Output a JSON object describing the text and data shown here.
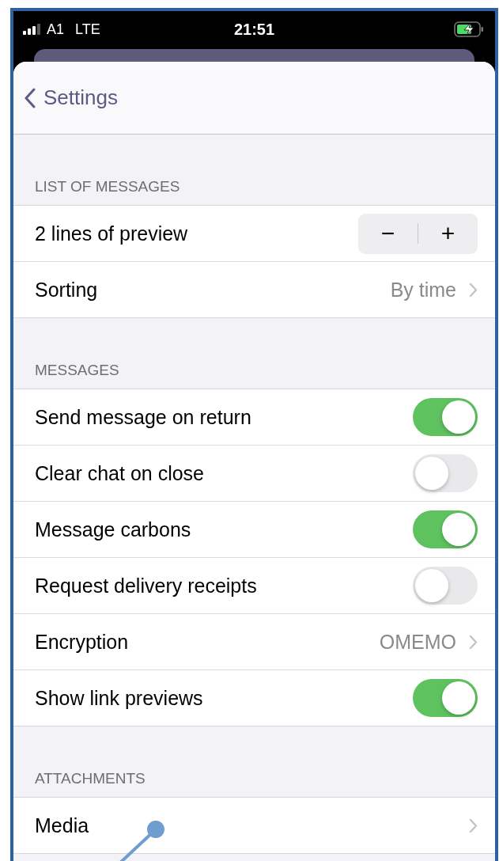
{
  "status_bar": {
    "carrier": "A1",
    "network": "LTE",
    "time": "21:51"
  },
  "nav": {
    "back_label": "Settings"
  },
  "sections": [
    {
      "header": "LIST OF MESSAGES",
      "rows": [
        {
          "kind": "stepper",
          "label": "2 lines of preview",
          "decrement": "−",
          "increment": "+"
        },
        {
          "kind": "disclosure",
          "label": "Sorting",
          "value": "By time"
        }
      ]
    },
    {
      "header": "MESSAGES",
      "rows": [
        {
          "kind": "toggle",
          "label": "Send message on return",
          "on": true
        },
        {
          "kind": "toggle",
          "label": "Clear chat on close",
          "on": false
        },
        {
          "kind": "toggle",
          "label": "Message carbons",
          "on": true
        },
        {
          "kind": "toggle",
          "label": "Request delivery receipts",
          "on": false
        },
        {
          "kind": "disclosure",
          "label": "Encryption",
          "value": "OMEMO"
        },
        {
          "kind": "toggle",
          "label": "Show link previews",
          "on": true
        }
      ]
    },
    {
      "header": "ATTACHMENTS",
      "rows": [
        {
          "kind": "disclosure",
          "label": "Media"
        }
      ]
    }
  ]
}
